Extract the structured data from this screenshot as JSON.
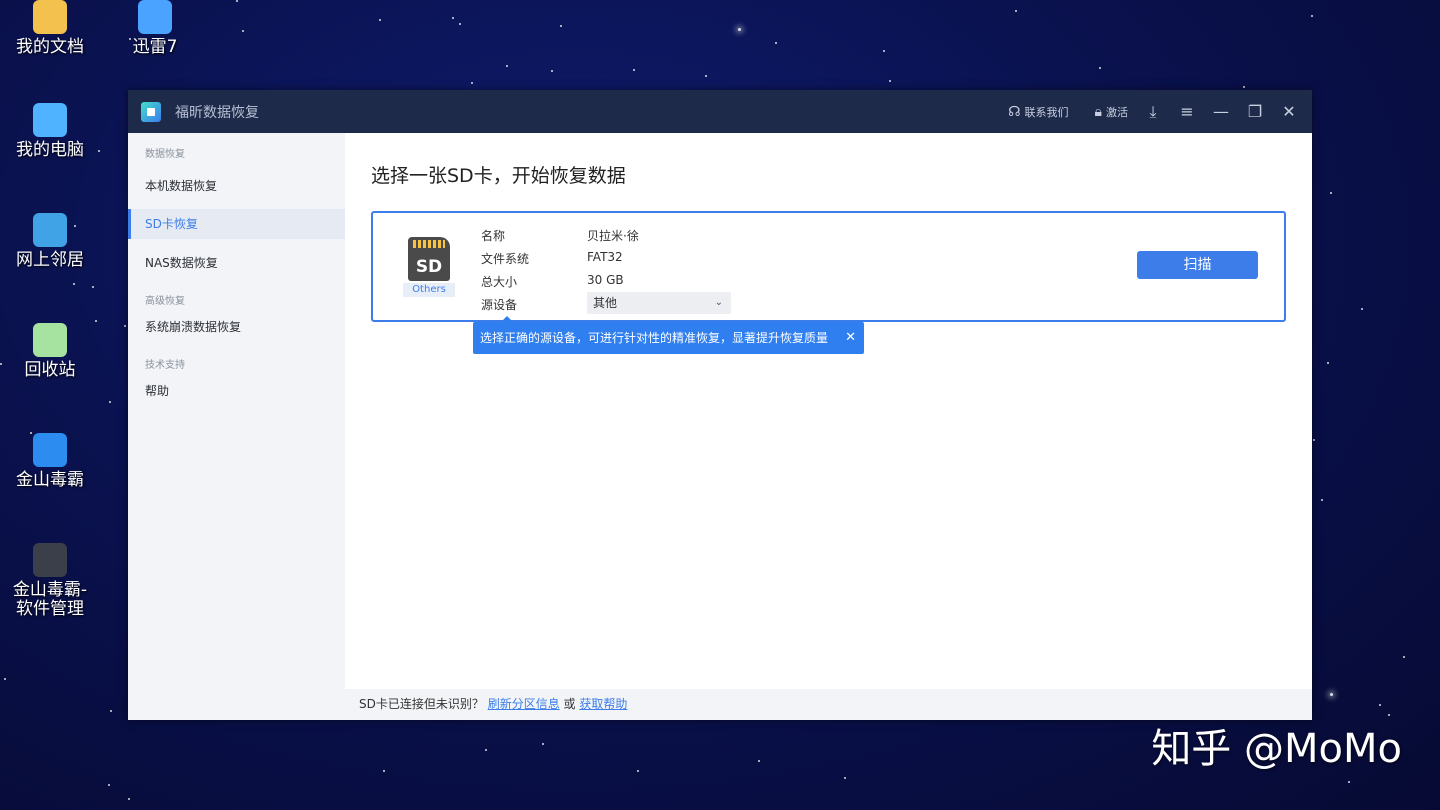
{
  "desktop": {
    "icons": [
      {
        "label": "我的文档",
        "icon": "documents-folder-icon",
        "color": "#f2c14e"
      },
      {
        "label": "迅雷7",
        "icon": "thunder-icon",
        "color": "#4aa3ff"
      },
      {
        "label": "我的电脑",
        "icon": "computer-icon",
        "color": "#4fb3ff"
      },
      {
        "label": "网上邻居",
        "icon": "network-icon",
        "color": "#3fa3e6"
      },
      {
        "label": "回收站",
        "icon": "recycle-bin-icon",
        "color": "#a6e3a1"
      },
      {
        "label": "金山毒霸",
        "icon": "antivirus-icon",
        "color": "#2d8cf0"
      },
      {
        "label": "金山毒霸-\n软件管理",
        "icon": "software-manager-icon",
        "color": "#3a3f4a"
      }
    ]
  },
  "window": {
    "title": "福昕数据恢复",
    "contact_label": "联系我们",
    "activate_label": "激活"
  },
  "sidebar": {
    "groups": [
      {
        "label": "数据恢复",
        "items": [
          "本机数据恢复",
          "SD卡恢复",
          "NAS数据恢复"
        ]
      },
      {
        "label": "高级恢复",
        "items": [
          "系统崩溃数据恢复"
        ]
      },
      {
        "label": "技术支持",
        "items": [
          "帮助"
        ]
      }
    ],
    "active_item": "SD卡恢复"
  },
  "main": {
    "title": "选择一张SD卡，开始恢复数据",
    "card": {
      "sd_text": "SD",
      "sd_label": "Others",
      "name_label": "名称",
      "name_value": "贝拉米·徐",
      "fs_label": "文件系统",
      "fs_value": "FAT32",
      "size_label": "总大小",
      "size_value": "30 GB",
      "source_label": "源设备",
      "source_value": "其他",
      "scan_label": "扫描"
    },
    "tooltip": "选择正确的源设备，可进行针对性的精准恢复，显著提升恢复质量"
  },
  "footer": {
    "text": "SD卡已连接但未识别？",
    "link1": "刷新分区信息",
    "or": "或",
    "link2": "获取帮助"
  },
  "watermark": "知乎 @MoMo",
  "colors": {
    "accent": "#3d7de9",
    "titlebar": "#1e2a4a"
  }
}
